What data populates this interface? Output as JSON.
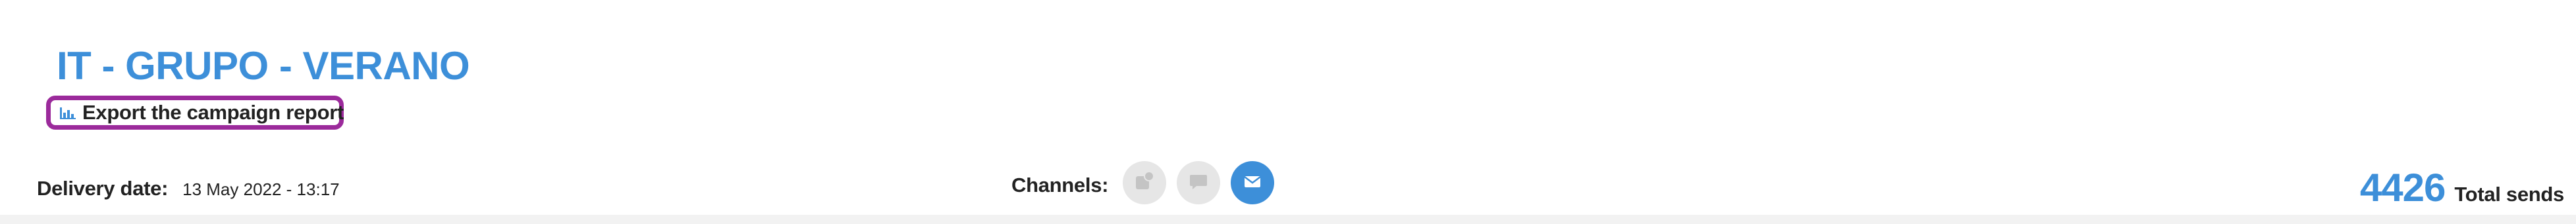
{
  "campaign": {
    "title": "IT - GRUPO - VERANO"
  },
  "actions": {
    "export_label": "Export the campaign report",
    "export_icon": "bar-chart-icon"
  },
  "delivery": {
    "label": "Delivery date:",
    "value": "13 May 2022 - 13:17"
  },
  "channels": {
    "label": "Channels:",
    "items": [
      {
        "icon": "push-notification-icon",
        "active": false
      },
      {
        "icon": "sms-chat-icon",
        "active": false
      },
      {
        "icon": "email-envelope-icon",
        "active": true
      }
    ]
  },
  "totals": {
    "count": "4426",
    "label": "Total sends"
  },
  "colors": {
    "accent": "#3d8fd9",
    "highlight_border": "#9b2a9b",
    "inactive_channel": "#e6e6e6"
  }
}
